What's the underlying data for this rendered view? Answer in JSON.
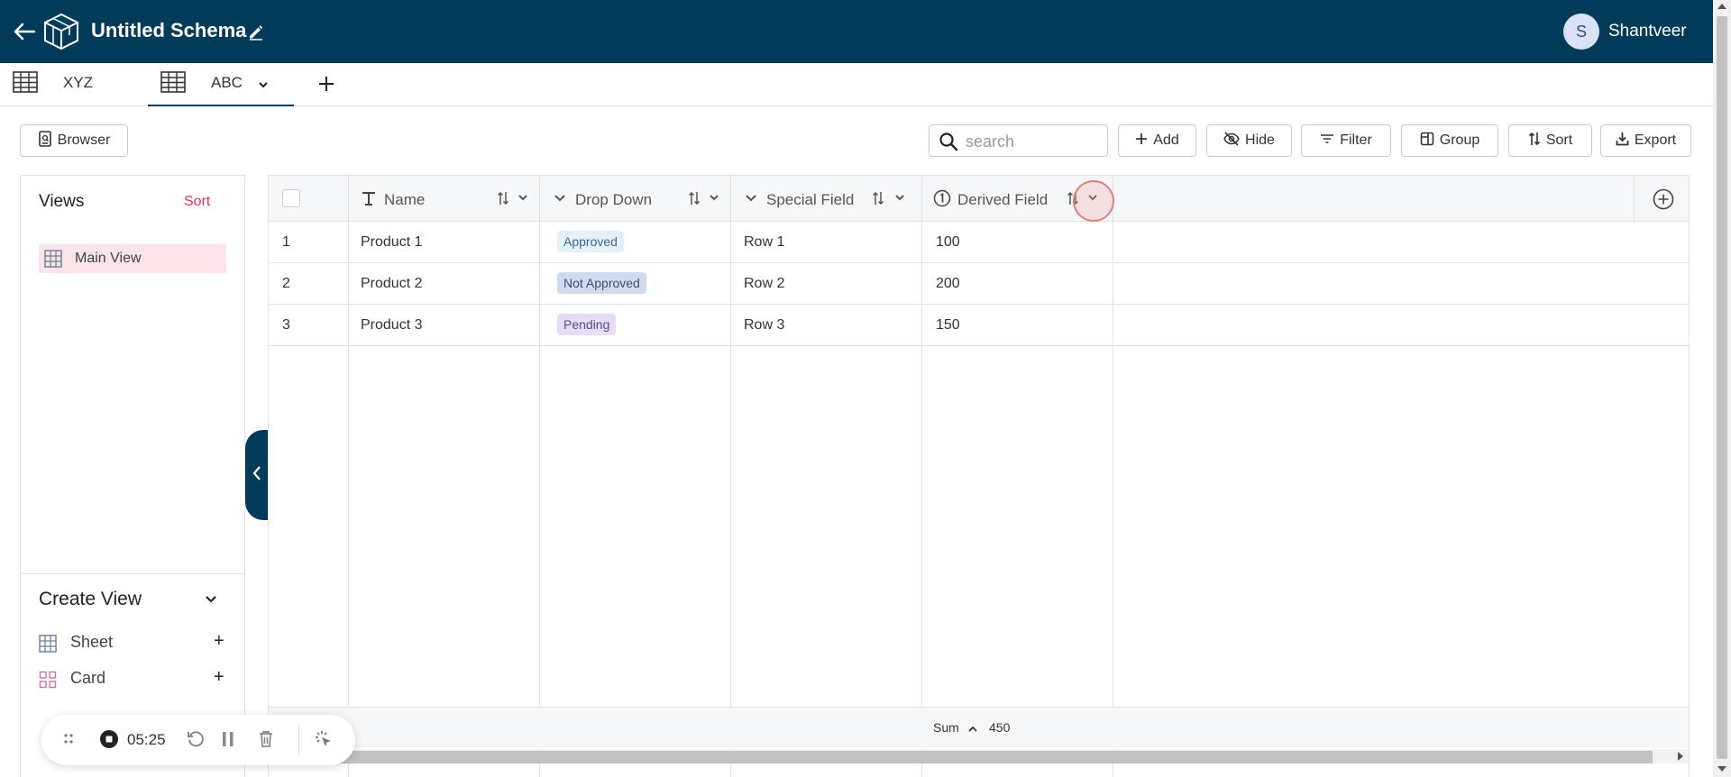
{
  "header": {
    "title": "Untitled Schema",
    "user_initial": "S",
    "user_name": "Shantveer"
  },
  "tabs": [
    {
      "label": "XYZ",
      "active": false
    },
    {
      "label": "ABC",
      "active": true
    }
  ],
  "toolbar": {
    "browser_label": "Browser",
    "search_placeholder": "search",
    "add_label": "Add",
    "hide_label": "Hide",
    "filter_label": "Filter",
    "group_label": "Group",
    "sort_label": "Sort",
    "export_label": "Export"
  },
  "sidebar": {
    "views_title": "Views",
    "views_sort": "Sort",
    "views": [
      {
        "label": "Main View",
        "icon": "grid-icon",
        "active": true
      }
    ],
    "create_title": "Create View",
    "create_items": [
      {
        "label": "Sheet",
        "icon": "sheet-grid-icon"
      },
      {
        "label": "Card",
        "icon": "card-grid-icon"
      }
    ]
  },
  "table": {
    "columns": [
      {
        "label": "Name",
        "icon": "text-type-icon"
      },
      {
        "label": "Drop Down",
        "icon": "dropdown-chevron-icon"
      },
      {
        "label": "Special Field",
        "icon": "dropdown-chevron-icon"
      },
      {
        "label": "Derived Field",
        "icon": "formula-circle-icon"
      }
    ],
    "rows": [
      {
        "num": "1",
        "name": "Product 1",
        "dropdown": "Approved",
        "special": "Row 1",
        "derived": "100"
      },
      {
        "num": "2",
        "name": "Product 2",
        "dropdown": "Not Approved",
        "special": "Row 2",
        "derived": "200"
      },
      {
        "num": "3",
        "name": "Product 3",
        "dropdown": "Pending",
        "special": "Row 3",
        "derived": "150"
      }
    ],
    "footer": {
      "sum_label": "Sum",
      "sum_value": "450"
    }
  },
  "recorder": {
    "time": "05:25"
  },
  "colors": {
    "brand": "#023a5a",
    "accent": "#d6336c",
    "approved_bg": "#e3f1fb",
    "not_approved_bg": "#cfdcf0",
    "pending_bg": "#e6dcf7"
  }
}
